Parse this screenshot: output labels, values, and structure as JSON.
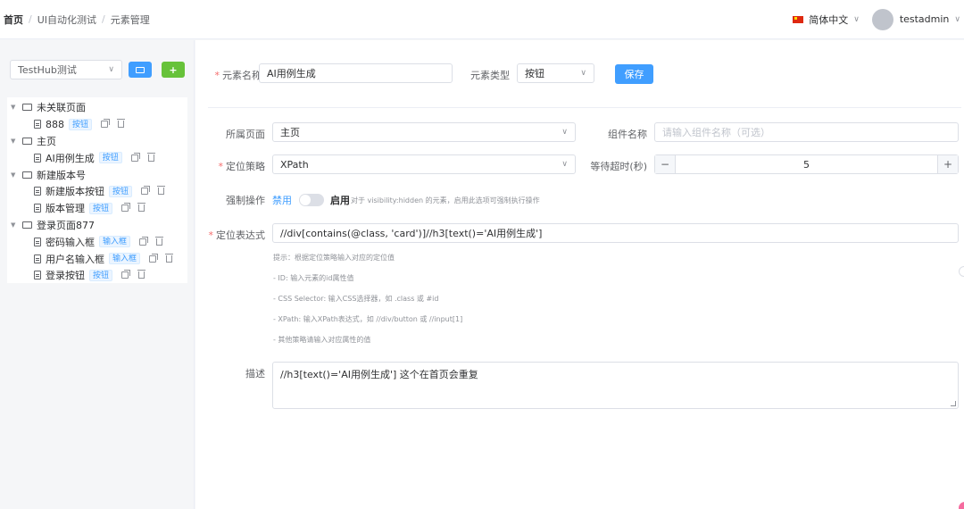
{
  "breadcrumb": [
    "首页",
    "UI自动化测试",
    "元素管理"
  ],
  "header": {
    "language": "简体中文",
    "username": "testadmin"
  },
  "sidebar": {
    "project": "TestHub测试",
    "tree": [
      {
        "name": "未关联页面",
        "children": [
          {
            "name": "888",
            "tag": "按钮"
          }
        ]
      },
      {
        "name": "主页",
        "children": [
          {
            "name": "AI用例生成",
            "tag": "按钮"
          }
        ]
      },
      {
        "name": "新建版本号",
        "children": [
          {
            "name": "新建版本按钮",
            "tag": "按钮"
          },
          {
            "name": "版本管理",
            "tag": "按钮"
          }
        ]
      },
      {
        "name": "登录页面877",
        "children": [
          {
            "name": "密码输入框",
            "tag": "输入框"
          },
          {
            "name": "用户名输入框",
            "tag": "输入框"
          },
          {
            "name": "登录按钮",
            "tag": "按钮"
          }
        ]
      }
    ]
  },
  "form": {
    "element_name": {
      "label": "元素名称",
      "value": "AI用例生成"
    },
    "element_type": {
      "label": "元素类型",
      "value": "按钮"
    },
    "save_label": "保存",
    "page": {
      "label": "所属页面",
      "value": "主页"
    },
    "component": {
      "label": "组件名称",
      "placeholder": "请输入组件名称（可选）"
    },
    "strategy": {
      "label": "定位策略",
      "value": "XPath"
    },
    "timeout": {
      "label": "等待超时(秒)",
      "value": "5",
      "minus": "−",
      "plus": "+"
    },
    "force": {
      "label": "强制操作",
      "off": "禁用",
      "on": "启用",
      "help": "对于 visibility:hidden 的元素，启用此选项可强制执行操作",
      "enabled": false
    },
    "locator": {
      "label": "定位表达式",
      "value": "//div[contains(@class, 'card')]//h3[text()='AI用例生成']"
    },
    "hints": [
      "提示：根据定位策略输入对应的定位值",
      "- ID: 输入元素的id属性值",
      "- CSS Selector: 输入CSS选择器，如 .class 或 #id",
      "- XPath: 输入XPath表达式，如 //div/button 或 //input[1]",
      "- 其他策略请输入对应属性的值"
    ],
    "description": {
      "label": "描述",
      "value": "//h3[text()='AI用例生成']  这个在首页会重复"
    }
  }
}
